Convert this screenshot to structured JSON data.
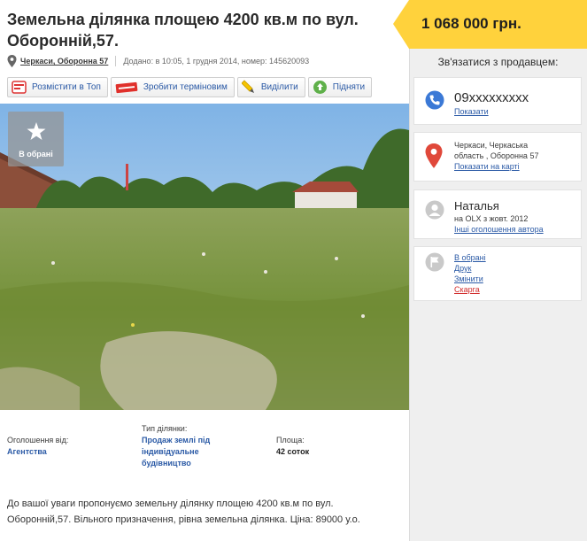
{
  "listing": {
    "title_line1": "Земельна ділянка площею 4200 кв.м по вул.",
    "title_line2": "Оборонній,57.",
    "location": "Черкаси, Оборонна 57",
    "added": "Додано: в 10:05, 1 грудня 2014, номер: 145620093"
  },
  "actions": [
    {
      "label": "Розмістити в Топ",
      "icon": "ad-icon"
    },
    {
      "label": "Зробити терміновим",
      "icon": "urgent-icon"
    },
    {
      "label": "Виділити",
      "icon": "highlight-pen-icon"
    },
    {
      "label": "Підняти",
      "icon": "raise-icon"
    }
  ],
  "favorite": {
    "label": "В обрані"
  },
  "details": {
    "offer_label": "Оголошення від:",
    "offer_value": "Агентства",
    "type_label": "Тип ділянки:",
    "type_value_1": "Продаж землі під",
    "type_value_2": "індивідуальне",
    "type_value_3": "будівництво",
    "area_label": "Площа:",
    "area_value": "42 соток"
  },
  "description_1": "До вашої уваги пропонуємо земельну ділянку площею 4200 кв.м по вул.",
  "description_2": "Оборонній,57. Вільного призначення, рівна земельна ділянка. Ціна: 89000 у.о.",
  "sidebar": {
    "price": "1 068 000 грн.",
    "contact_title": "Зв'язатися з продавцем:",
    "phone": "09xxxxxxxxx",
    "show": "Показати",
    "address_1": "Черкаси, Черкаська",
    "address_2": "область , Оборонна 57",
    "map_link": "Показати на карті",
    "user_name": "Наталья",
    "user_since": "на OLX з жовт. 2012",
    "user_other": "Інші оголошення автора",
    "tool_fav": "В обрані",
    "tool_print": "Друк",
    "tool_edit": "Змінити",
    "tool_report": "Скарга"
  },
  "colors": {
    "accent": "#ffd23c",
    "link": "#2b5aa6",
    "phone_icon": "#3b79d6",
    "map_pin": "#e0483a"
  }
}
